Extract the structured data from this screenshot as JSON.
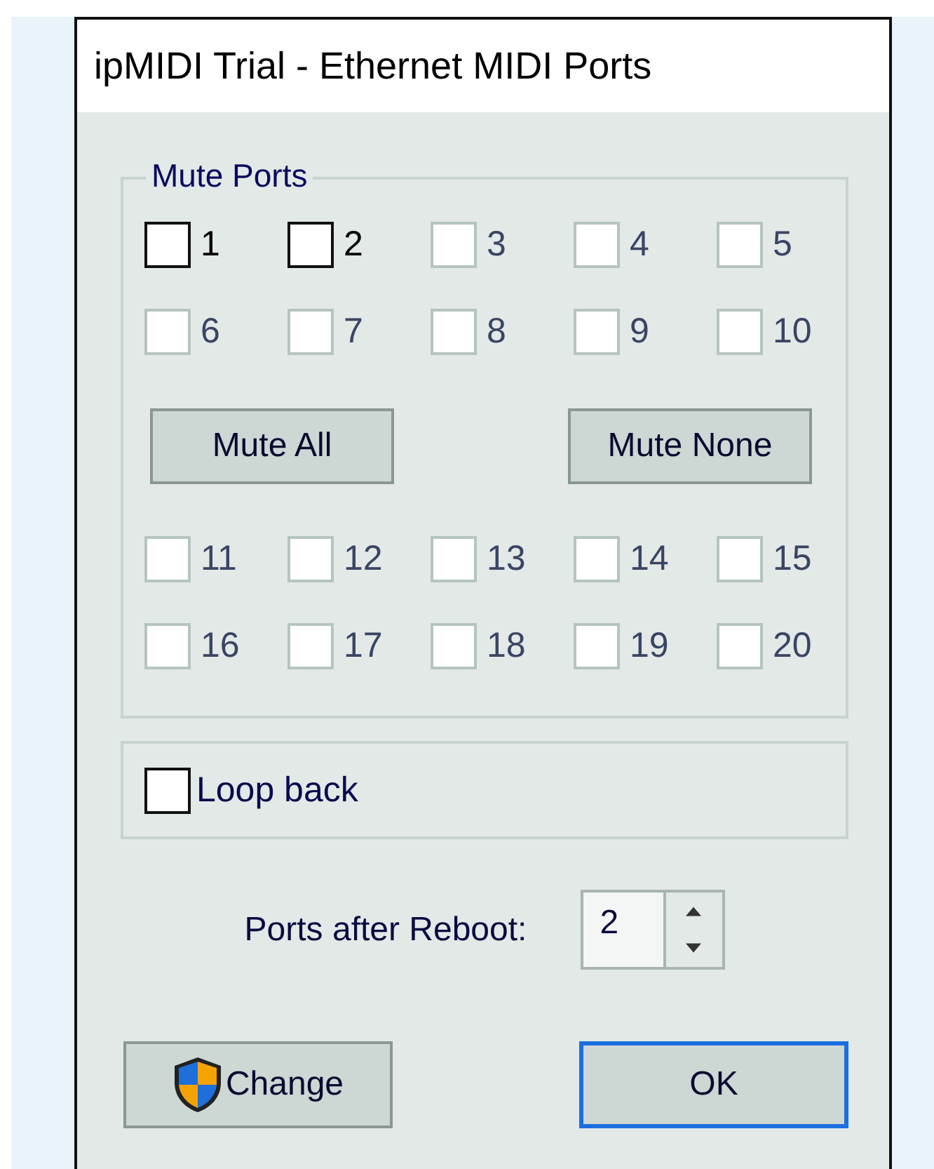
{
  "window": {
    "title": "ipMIDI Trial - Ethernet MIDI Ports"
  },
  "mute_ports": {
    "label": "Mute Ports",
    "ports": [
      {
        "label": "1",
        "checked": false,
        "disabled": false
      },
      {
        "label": "2",
        "checked": false,
        "disabled": false
      },
      {
        "label": "3",
        "checked": false,
        "disabled": true
      },
      {
        "label": "4",
        "checked": false,
        "disabled": true
      },
      {
        "label": "5",
        "checked": false,
        "disabled": true
      },
      {
        "label": "6",
        "checked": false,
        "disabled": true
      },
      {
        "label": "7",
        "checked": false,
        "disabled": true
      },
      {
        "label": "8",
        "checked": false,
        "disabled": true
      },
      {
        "label": "9",
        "checked": false,
        "disabled": true
      },
      {
        "label": "10",
        "checked": false,
        "disabled": true
      },
      {
        "label": "11",
        "checked": false,
        "disabled": true
      },
      {
        "label": "12",
        "checked": false,
        "disabled": true
      },
      {
        "label": "13",
        "checked": false,
        "disabled": true
      },
      {
        "label": "14",
        "checked": false,
        "disabled": true
      },
      {
        "label": "15",
        "checked": false,
        "disabled": true
      },
      {
        "label": "16",
        "checked": false,
        "disabled": true
      },
      {
        "label": "17",
        "checked": false,
        "disabled": true
      },
      {
        "label": "18",
        "checked": false,
        "disabled": true
      },
      {
        "label": "19",
        "checked": false,
        "disabled": true
      },
      {
        "label": "20",
        "checked": false,
        "disabled": true
      }
    ],
    "buttons": [
      "Mute All",
      "Mute None"
    ]
  },
  "loop_back": {
    "label": "Loop back",
    "checked": false
  },
  "ports_after_reboot": {
    "label": "Ports after Reboot:",
    "value": "2"
  },
  "buttons": [
    {
      "label": "Change",
      "kind": "shield",
      "default": false
    },
    {
      "label": "OK",
      "kind": "plain",
      "default": true
    }
  ]
}
